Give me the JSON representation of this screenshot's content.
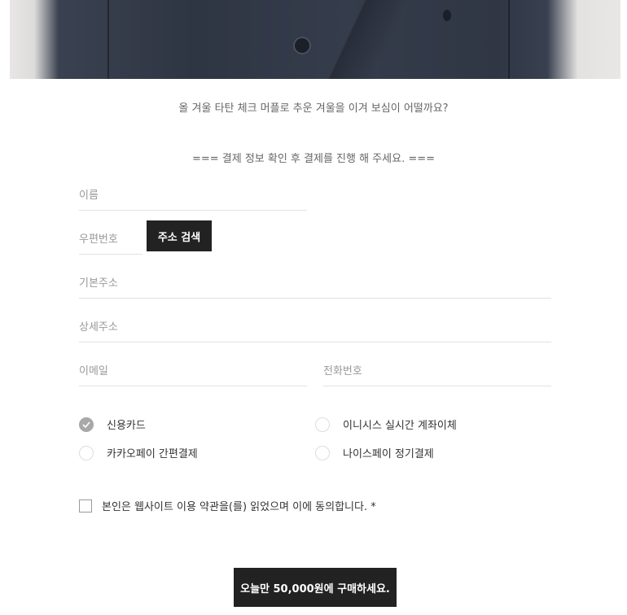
{
  "tagline": "올 겨울 타탄 체크 머플로 추운 겨울을 이겨 보심이 어떨까요?",
  "notice": "=== 결제 정보 확인 후 결제를 진행 해 주세요. ===",
  "form": {
    "name_placeholder": "이름",
    "zip_placeholder": "우편번호",
    "address_search_label": "주소 검색",
    "address_placeholder": "기본주소",
    "address_detail_placeholder": "상세주소",
    "email_placeholder": "이메일",
    "phone_placeholder": "전화번호"
  },
  "payment_methods": [
    {
      "label": "신용카드",
      "selected": true
    },
    {
      "label": "이니시스 실시간 계좌이체",
      "selected": false
    },
    {
      "label": "카카오페이 간편결제",
      "selected": false
    },
    {
      "label": "나이스페이 정기결제",
      "selected": false
    }
  ],
  "agreement": "본인은 웹사이트 이용 약관을(를) 읽었으며 이에 동의합니다. *",
  "buy_button": "오늘만 50,000원에 구매하세요.",
  "colors": {
    "button_bg": "#222222",
    "checked_radio": "#a8a8a8"
  }
}
